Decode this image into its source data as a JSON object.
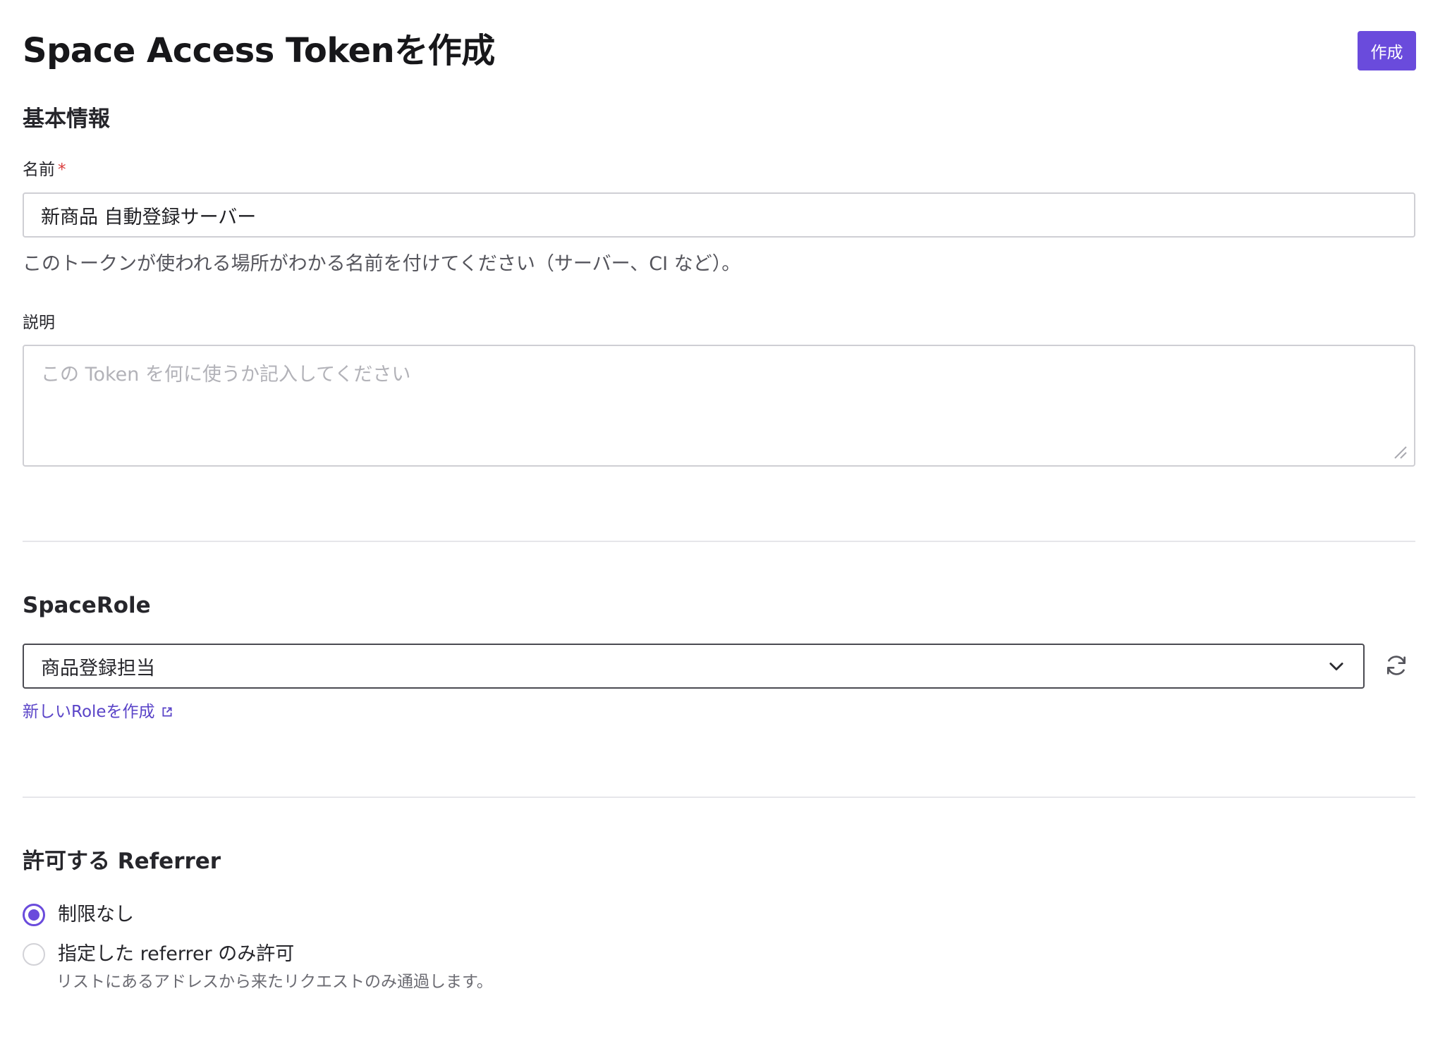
{
  "header": {
    "title": "Space Access Tokenを作成",
    "create_button_label": "作成"
  },
  "basic_info": {
    "heading": "基本情報",
    "name": {
      "label": "名前",
      "required_mark": "*",
      "value": "新商品 自動登録サーバー",
      "help": "このトークンが使われる場所がわかる名前を付けてください（サーバー、CI など）。"
    },
    "description": {
      "label": "説明",
      "value": "",
      "placeholder": "この Token を何に使うか記入してください"
    }
  },
  "space_role": {
    "heading": "SpaceRole",
    "selected": "商品登録担当",
    "new_role_link": "新しいRoleを作成"
  },
  "referrer": {
    "heading": "許可する Referrer",
    "options": [
      {
        "label": "制限なし",
        "checked": true
      },
      {
        "label": "指定した referrer のみ許可",
        "checked": false,
        "description": "リストにあるアドレスから来たリクエストのみ通過します。"
      }
    ]
  },
  "colors": {
    "accent": "#6a4bdc",
    "link": "#5a44c8",
    "required": "#d93c3c"
  }
}
